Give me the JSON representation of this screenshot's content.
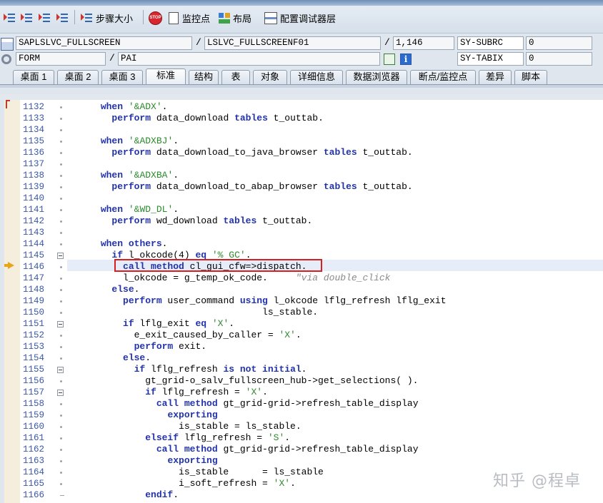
{
  "toolbar": {
    "buttons": [
      {
        "icon": "outdent-lines-icon",
        "label": ""
      },
      {
        "icon": "indent-lines-icon",
        "label": ""
      },
      {
        "icon": "shift-lines-icon",
        "label": ""
      },
      {
        "icon": "sort-lines-icon",
        "label": ""
      },
      {
        "icon": "step-size-icon",
        "label": "步骤大小"
      },
      {
        "icon": "stop-icon",
        "label": ""
      },
      {
        "icon": "watchpoint-icon",
        "label": "监控点"
      },
      {
        "icon": "layout-icon",
        "label": "布局"
      },
      {
        "icon": "configure-debugger-layer-icon",
        "label": "配置调试器层"
      }
    ]
  },
  "fields": {
    "program": "SAPLSLVC_FULLSCREEN",
    "include": "LSLVC_FULLSCREENF01",
    "line": "1,146",
    "sy_subrc_label": "SY-SUBRC",
    "sy_subrc_value": "0",
    "event_type": "FORM",
    "event_name": "PAI",
    "sy_tabix_label": "SY-TABIX",
    "sy_tabix_value": "0"
  },
  "tabs": [
    {
      "label": "桌面 1"
    },
    {
      "label": "桌面 2"
    },
    {
      "label": "桌面 3"
    },
    {
      "label": "标准",
      "active": true
    },
    {
      "label": "结构"
    },
    {
      "label": "表"
    },
    {
      "label": "对象"
    },
    {
      "label": "详细信息"
    },
    {
      "label": "数据浏览器"
    },
    {
      "label": "断点/监控点"
    },
    {
      "label": "差异"
    },
    {
      "label": "脚本"
    }
  ],
  "code_lines": [
    {
      "n": "1132",
      "t": "      <k>when</k> <s>'&ADX'</s>."
    },
    {
      "n": "1133",
      "t": "        <k>perform</k> data_download <k>tables</k> t_outtab."
    },
    {
      "n": "1134",
      "t": ""
    },
    {
      "n": "1135",
      "t": "      <k>when</k> <s>'&ADXBJ'</s>."
    },
    {
      "n": "1136",
      "t": "        <k>perform</k> data_download_to_java_browser <k>tables</k> t_outtab."
    },
    {
      "n": "1137",
      "t": ""
    },
    {
      "n": "1138",
      "t": "      <k>when</k> <s>'&ADXBA'</s>."
    },
    {
      "n": "1139",
      "t": "        <k>perform</k> data_download_to_abap_browser <k>tables</k> t_outtab."
    },
    {
      "n": "1140",
      "t": ""
    },
    {
      "n": "1141",
      "t": "      <k>when</k> <s>'&WD_DL'</s>."
    },
    {
      "n": "1142",
      "t": "        <k>perform</k> wd_download <k>tables</k> t_outtab."
    },
    {
      "n": "1143",
      "t": ""
    },
    {
      "n": "1144",
      "t": "      <k>when</k> <k>others</k>."
    },
    {
      "n": "1145",
      "t": "        <k>if</k> l_okcode(4) <k>eq</k> <s>'% GC'</s>."
    },
    {
      "n": "1146",
      "t": "          <k>call method</k> cl_gui_cfw=>dispatch."
    },
    {
      "n": "1147",
      "t": "          l_okcode = g_temp_ok_code.     <c>\"via double_click</c>"
    },
    {
      "n": "1148",
      "t": "        <k>else</k>."
    },
    {
      "n": "1149",
      "t": "          <k>perform</k> user_command <k>using</k> l_okcode lflg_refresh lflg_exit"
    },
    {
      "n": "1150",
      "t": "                                   ls_stable."
    },
    {
      "n": "1151",
      "t": "          <k>if</k> lflg_exit <k>eq</k> <s>'X'</s>."
    },
    {
      "n": "1152",
      "t": "            e_exit_caused_by_caller = <s>'X'</s>."
    },
    {
      "n": "1153",
      "t": "            <k>perform</k> exit."
    },
    {
      "n": "1154",
      "t": "          <k>else</k>."
    },
    {
      "n": "1155",
      "t": "            <k>if</k> lflg_refresh <k>is not initial</k>."
    },
    {
      "n": "1156",
      "t": "              gt_grid-o_salv_fullscreen_hub->get_selections( )."
    },
    {
      "n": "1157",
      "t": "              <k>if</k> lflg_refresh = <s>'X'</s>."
    },
    {
      "n": "1158",
      "t": "                <k>call method</k> gt_grid-grid->refresh_table_display"
    },
    {
      "n": "1159",
      "t": "                  <k>exporting</k>"
    },
    {
      "n": "1160",
      "t": "                    is_stable = ls_stable."
    },
    {
      "n": "1161",
      "t": "              <k>elseif</k> lflg_refresh = <s>'S'</s>."
    },
    {
      "n": "1162",
      "t": "                <k>call method</k> gt_grid-grid->refresh_table_display"
    },
    {
      "n": "1163",
      "t": "                  <k>exporting</k>"
    },
    {
      "n": "1164",
      "t": "                    is_stable      = ls_stable"
    },
    {
      "n": "1165",
      "t": "                    i_soft_refresh = <s>'X'</s>."
    },
    {
      "n": "1166",
      "t": "              <k>endif</k>."
    }
  ],
  "current_line": "1146",
  "watermark": "知乎 @程卓"
}
